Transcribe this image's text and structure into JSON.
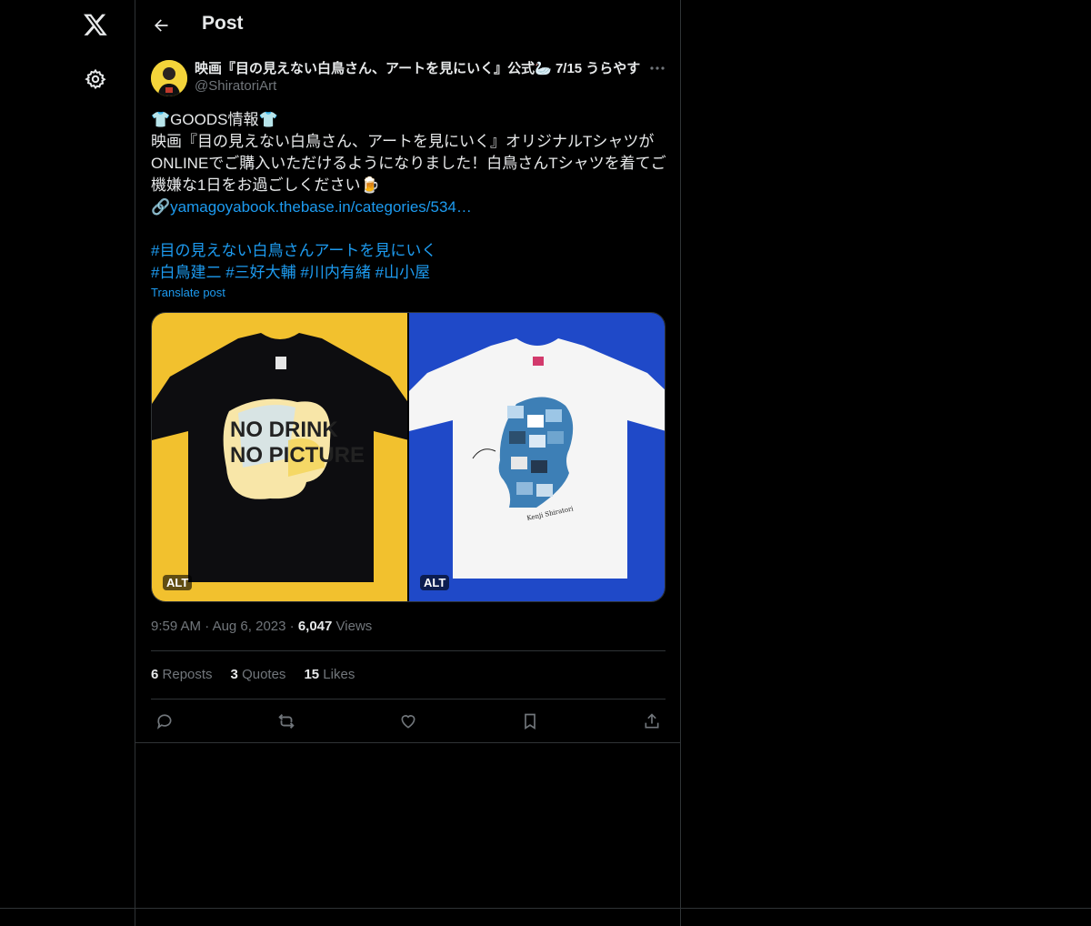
{
  "header": {
    "title": "Post"
  },
  "post": {
    "author": {
      "name": "映画『目の見えない白鳥さん、アートを見にいく』公式🦢 7/15 うらやす",
      "handle": "@ShiratoriArt"
    },
    "body_lines": [
      "👕GOODS情報👕",
      "映画『目の見えない白鳥さん、アートを見にいく』オリジナルTシャツが",
      "ONLINEでご購入いただけるようになりました！白鳥さんTシャツを着てご",
      "機嫌な1日をお過ごしください🍺"
    ],
    "link_prefix": "🔗",
    "link": "yamagoyabook.thebase.in/categories/534…",
    "hashtag_line_1": "#目の見えない白鳥さんアートを見にいく",
    "hashtags_line_2": [
      "#白鳥建二",
      "#三好大輔",
      "#川内有緒",
      "#山小屋"
    ],
    "translate": "Translate post",
    "media": [
      {
        "alt_badge": "ALT",
        "shirt_text_1": "NO DRINK",
        "shirt_text_2": "NO PICTURE",
        "background": "#f2c12e",
        "shirt_color": "#0d0d10"
      },
      {
        "alt_badge": "ALT",
        "shirt_text_1": "Kenji Shiratori",
        "background": "#1f49c8",
        "shirt_color": "#f5f5f5"
      }
    ],
    "time": "9:59 AM",
    "date": "Aug 6, 2023",
    "views_count": "6,047",
    "views_label": "Views",
    "sep": "·",
    "stats": [
      {
        "count": "6",
        "label": "Reposts"
      },
      {
        "count": "3",
        "label": "Quotes"
      },
      {
        "count": "15",
        "label": "Likes"
      }
    ],
    "actions": [
      "reply-icon",
      "repost-icon",
      "like-icon",
      "bookmark-icon",
      "share-icon"
    ]
  },
  "colors": {
    "accent": "#1d9bf0",
    "muted": "#71767b",
    "text": "#e7e9ea",
    "border": "#2f3336"
  }
}
